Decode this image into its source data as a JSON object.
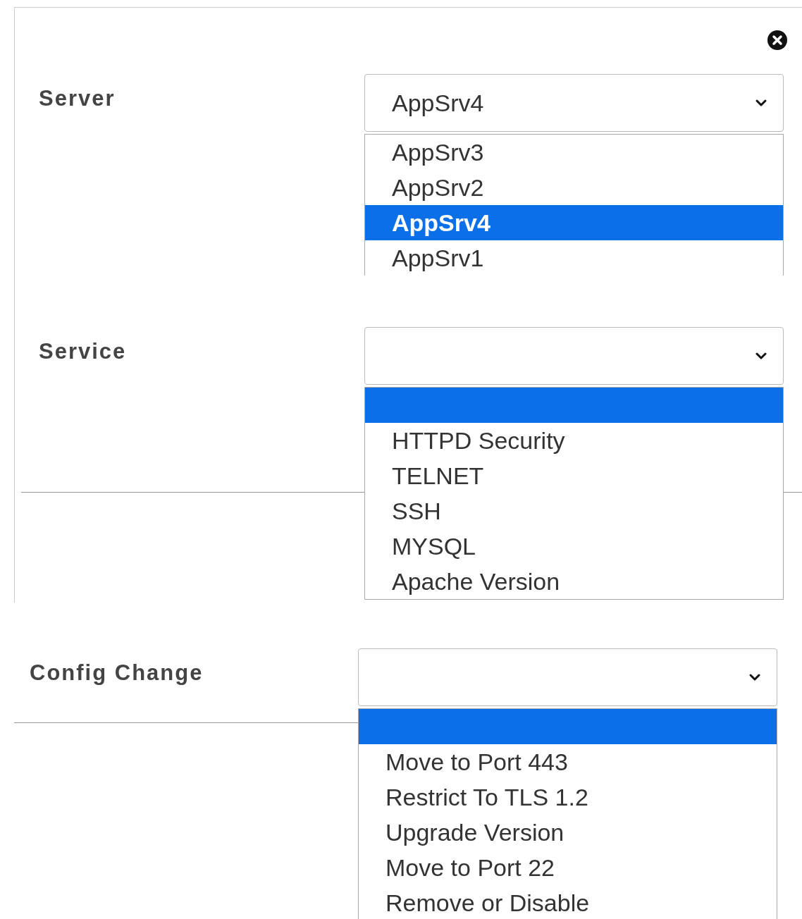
{
  "fields": [
    {
      "label": "Server",
      "value": "AppSrv4",
      "list_cut": true,
      "options": [
        {
          "label": "AppSrv3",
          "selected": false
        },
        {
          "label": "AppSrv2",
          "selected": false
        },
        {
          "label": "AppSrv4",
          "selected": true
        },
        {
          "label": "AppSrv1",
          "selected": false
        }
      ]
    },
    {
      "label": "Service",
      "list_cut": false,
      "options": [
        {
          "selected": true
        },
        {
          "label": "HTTPD Security",
          "selected": false
        },
        {
          "label": "TELNET",
          "selected": false
        },
        {
          "label": "SSH",
          "selected": false
        },
        {
          "label": "MYSQL",
          "selected": false
        },
        {
          "label": "Apache Version",
          "selected": false
        }
      ]
    },
    {
      "label": "Config Change",
      "list_cut": false,
      "options": [
        {
          "selected": true
        },
        {
          "label": "Move to Port 443",
          "selected": false
        },
        {
          "label": "Restrict To TLS 1.2",
          "selected": false
        },
        {
          "label": "Upgrade Version",
          "selected": false
        },
        {
          "label": "Move to Port 22",
          "selected": false
        },
        {
          "label": "Remove or Disable",
          "selected": false
        }
      ]
    }
  ]
}
